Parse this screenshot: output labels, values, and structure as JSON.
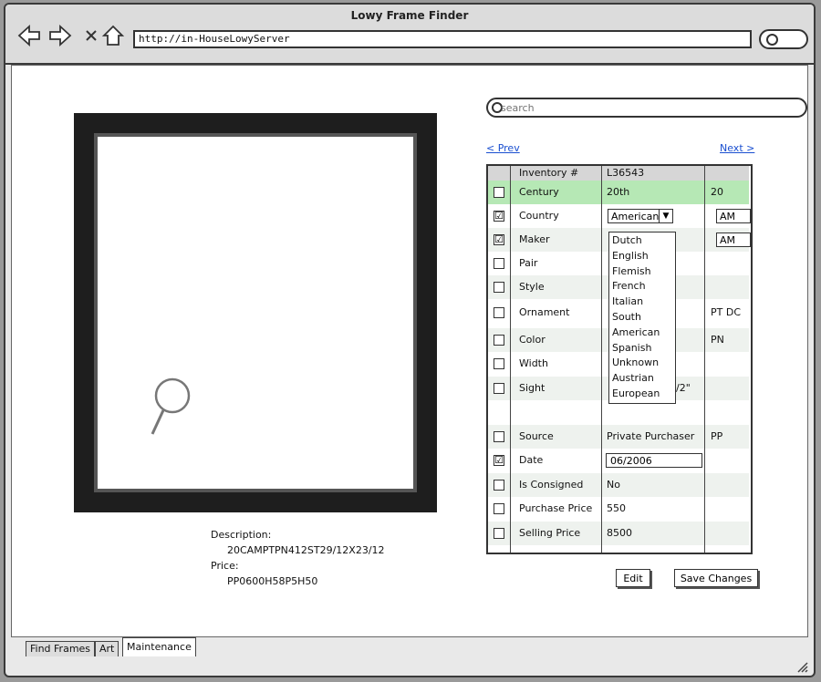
{
  "window": {
    "title": "Lowy Frame Finder",
    "url": "http://in-HouseLowyServer"
  },
  "search": {
    "placeholder": "search"
  },
  "nav": {
    "prev": "< Prev",
    "next": "Next >"
  },
  "details": {
    "description_label": "Description:",
    "description_value": "20CAMPTPN412ST29/12X23/12",
    "price_label": "Price:",
    "price_value": "PP0600H58P5H50"
  },
  "grid": {
    "header": {
      "label": "Inventory #",
      "value": "L36543"
    },
    "rows": [
      {
        "label": "Century",
        "value": "20th",
        "code": "20",
        "checked": ""
      },
      {
        "label": "Country",
        "value": "",
        "code": "AM",
        "checked": "☑"
      },
      {
        "label": "Maker",
        "value": "",
        "code": "AM",
        "checked": "☑"
      },
      {
        "label": "Pair",
        "value": "",
        "code": "",
        "checked": ""
      },
      {
        "label": "Style",
        "value": "",
        "code": "",
        "checked": ""
      },
      {
        "label": "Ornament",
        "value": "",
        "code": "PT DC",
        "checked": ""
      },
      {
        "label": "Color",
        "value": "",
        "code": "PN",
        "checked": ""
      },
      {
        "label": "Width",
        "value": "",
        "code": "",
        "checked": ""
      },
      {
        "label": "Sight",
        "value": "/2\"",
        "code": "",
        "checked": ""
      },
      {
        "label": "Source",
        "value": "Private Purchaser",
        "code": "PP",
        "checked": ""
      },
      {
        "label": "Date",
        "value": "06/2006",
        "code": "",
        "checked": "☑"
      },
      {
        "label": "Is Consigned",
        "value": "No",
        "code": "",
        "checked": ""
      },
      {
        "label": "Purchase Price",
        "value": "550",
        "code": "",
        "checked": ""
      },
      {
        "label": "Selling Price",
        "value": "8500",
        "code": "",
        "checked": ""
      }
    ],
    "country_select": "American",
    "country_options": [
      "Dutch",
      "English",
      "Flemish",
      "French",
      "Italian",
      "South",
      "American",
      "Spanish",
      "Unknown",
      "Austrian",
      "European"
    ]
  },
  "buttons": {
    "edit": "Edit",
    "save": "Save Changes"
  },
  "tabs": [
    "Find Frames",
    "Art",
    "Maintenance"
  ]
}
